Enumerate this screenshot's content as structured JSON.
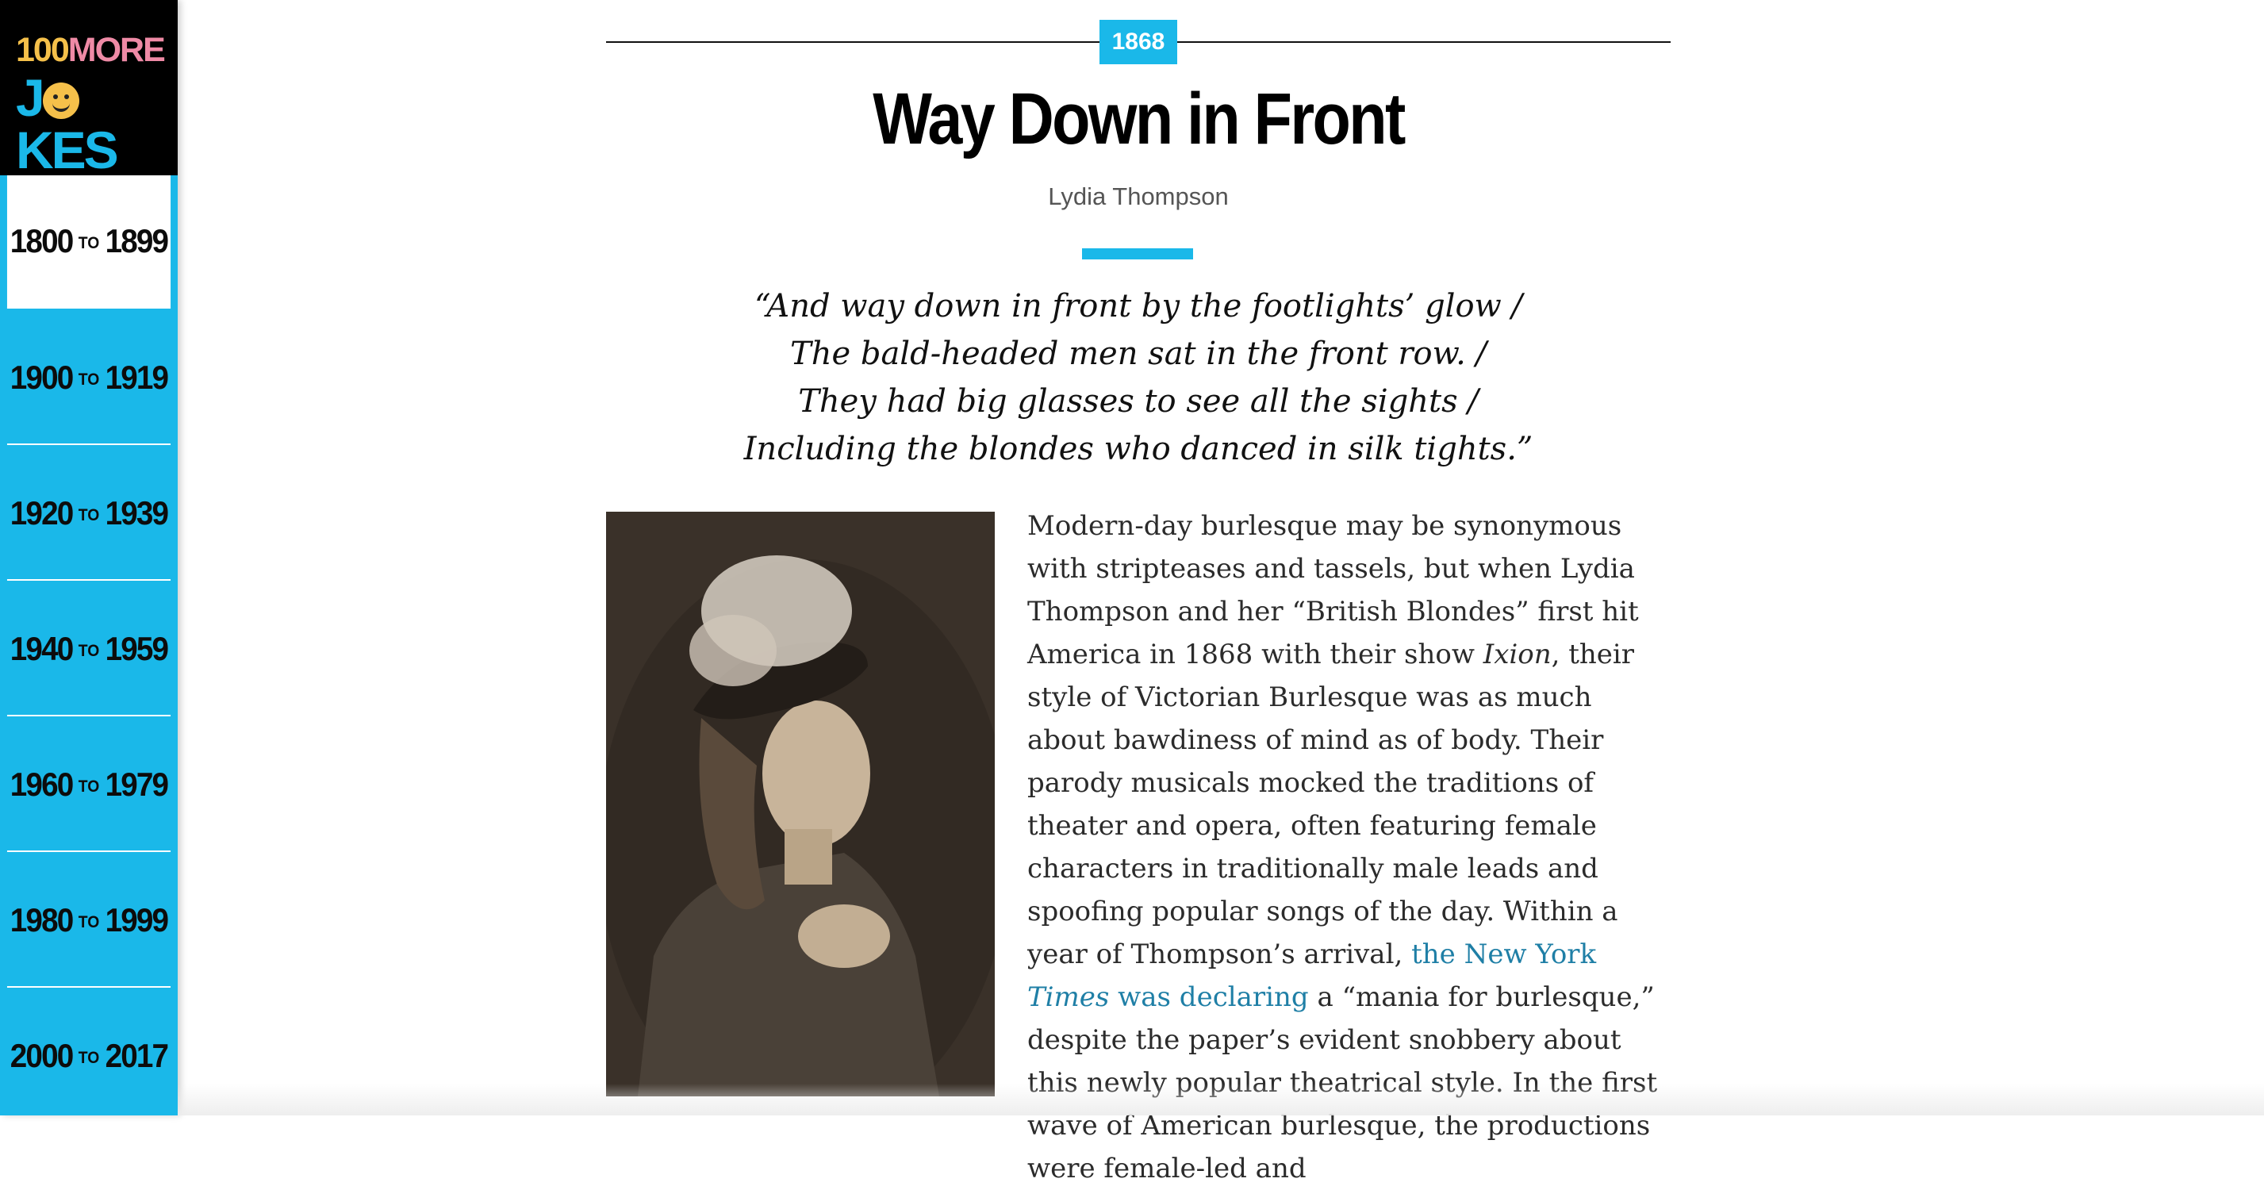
{
  "logo": {
    "line1_a": "100",
    "line1_b": "MORE",
    "line2_a": "J",
    "line2_b": "KES"
  },
  "nav": [
    {
      "from": "1800",
      "to_word": "TO",
      "to": "1899",
      "active": true
    },
    {
      "from": "1900",
      "to_word": "TO",
      "to": "1919"
    },
    {
      "from": "1920",
      "to_word": "TO",
      "to": "1939"
    },
    {
      "from": "1940",
      "to_word": "TO",
      "to": "1959"
    },
    {
      "from": "1960",
      "to_word": "TO",
      "to": "1979"
    },
    {
      "from": "1980",
      "to_word": "TO",
      "to": "1999"
    },
    {
      "from": "2000",
      "to_word": "TO",
      "to": "2017"
    }
  ],
  "article": {
    "year": "1868",
    "title": "Way Down in Front",
    "author": "Lydia Thompson",
    "quote": [
      "“And way down in front by the footlights’ glow /",
      "The bald-headed men sat in the front row. /",
      "They had big glasses to see all the sights /",
      "Including the blondes who danced in silk tights.”"
    ],
    "body": {
      "p1": "Modern-day burlesque may be synonymous with stripteases and tassels, but when Lydia Thompson and her “British Blondes” first hit America in 1868 with their show ",
      "show_title": "Ixion",
      "p2": ", their style of Victorian Burlesque was as much about bawdiness of mind as of body. Their parody musicals mocked the traditions of theater and opera, often featuring female characters in traditionally male leads and spoofing popular songs of the day. Within a year of Thompson’s arrival, ",
      "link_a": "the New York ",
      "link_b": "Times",
      "link_c": " was declaring",
      "p3": " a “mania for burlesque,” despite the paper’s evident snobbery about this newly popular theatrical style. In the first wave of American burlesque, the productions were female-led and"
    }
  },
  "colors": {
    "accent": "#1ab8e9",
    "link": "#1f7fa6",
    "logo_yellow": "#f5c04a",
    "logo_pink": "#ef8aa6"
  }
}
